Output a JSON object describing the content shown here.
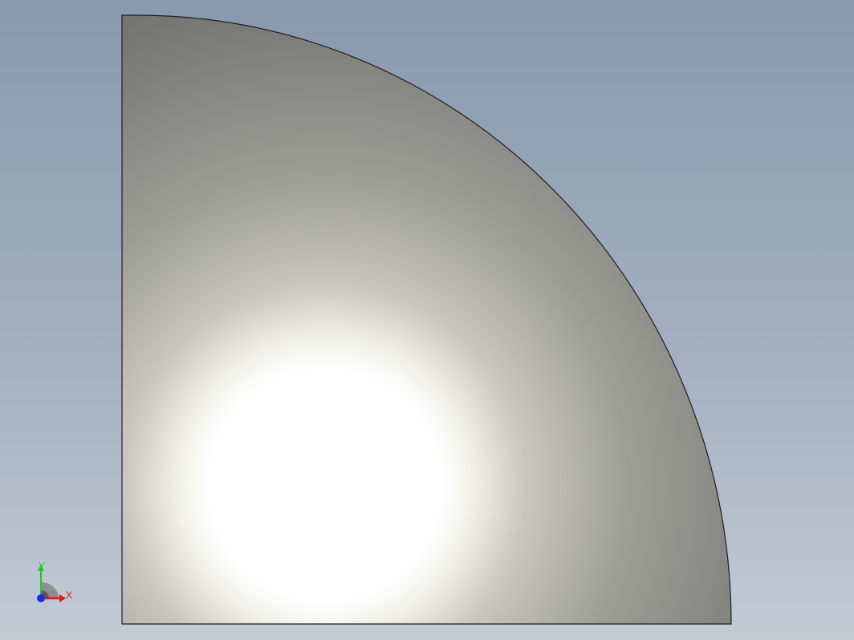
{
  "viewport": {
    "background_top": "#8799ae",
    "background_bottom": "#c3cad4"
  },
  "model": {
    "shape": "quarter-disc",
    "fill_highlight": "#ffffff",
    "fill_mid": "#9e9e98",
    "fill_shadow": "#616161",
    "edge_color": "#1e1e1e"
  },
  "triad": {
    "x_label": "X",
    "y_label": "Y",
    "x_color": "#e8141c",
    "y_color": "#1ec81e",
    "z_color": "#1a2cf0"
  }
}
